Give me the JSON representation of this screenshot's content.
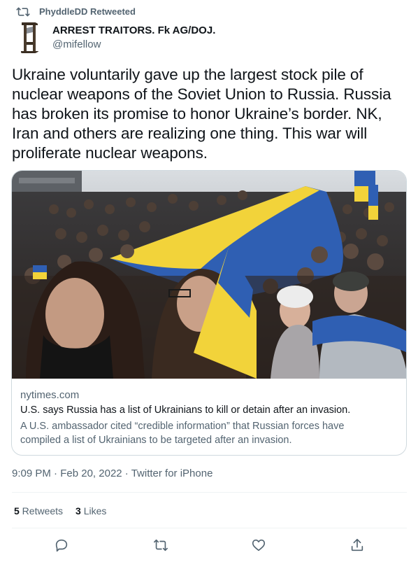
{
  "retweet_banner": {
    "label": "PhyddleDD Retweeted",
    "icon": "retweet-icon"
  },
  "author": {
    "display_name": "ARREST TRAITORS. Fk AG/DOJ.",
    "handle": "@mifellow",
    "avatar_icon": "guillotine-avatar"
  },
  "tweet": {
    "text": "Ukraine voluntarily gave up the largest stock pile of nuclear weapons of the Soviet Union to Russia. Russia has broken its promise to honor Ukraine’s border. NK, Iran and others are realizing one thing. This war will proliferate nuclear weapons."
  },
  "card": {
    "image_description_icon": "crowd-with-ukrainian-flag-photo",
    "domain": "nytimes.com",
    "title": "U.S. says Russia has a list of Ukrainians to kill or detain after an invasion.",
    "description": "A U.S. ambassador cited “credible information” that Russian forces have compiled a list of Ukrainians to be targeted after an invasion."
  },
  "meta": {
    "time": "9:09 PM",
    "separator": " · ",
    "date": "Feb 20, 2022",
    "source": "Twitter for iPhone"
  },
  "stats": {
    "retweets_count": "5",
    "retweets_label": " Retweets",
    "likes_count": "3",
    "likes_label": " Likes"
  },
  "actions": {
    "reply_icon": "reply-icon",
    "retweet_icon": "retweet-icon",
    "like_icon": "heart-icon",
    "share_icon": "share-icon"
  },
  "colors": {
    "text_primary": "#0f1419",
    "text_secondary": "#536471",
    "border": "#cfd9de",
    "flag_blue": "#2f5fb3",
    "flag_yellow": "#f2d33a"
  }
}
